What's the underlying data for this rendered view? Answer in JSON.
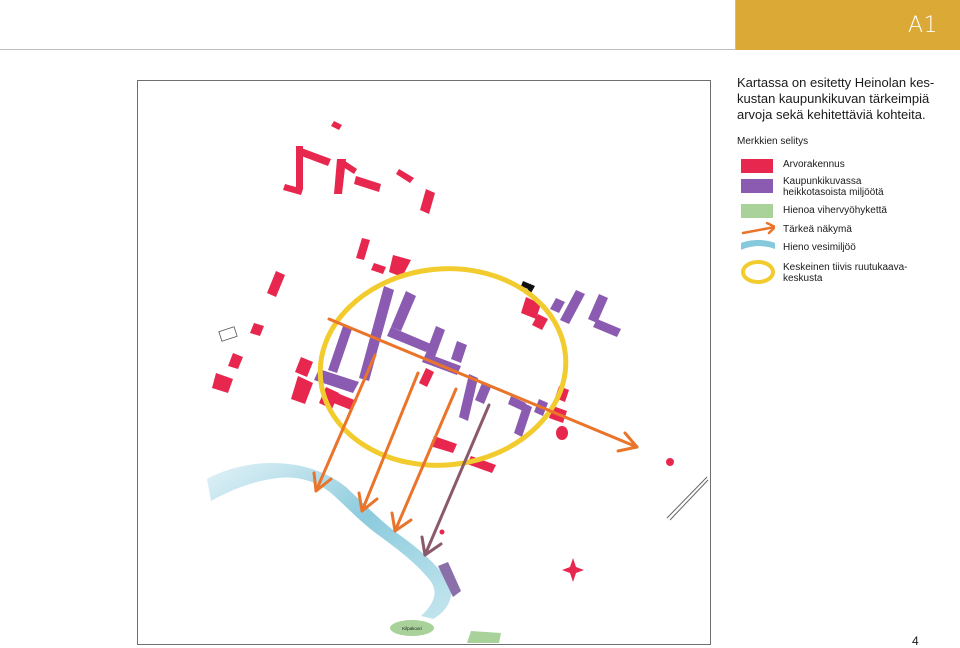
{
  "badge": {
    "label": "A1",
    "color": "#dba935"
  },
  "intro": {
    "lines": [
      "Kartassa on esitetty Heinolan kes-",
      "kustan kaupunkikuvan tärkeimpiä",
      "arvoja sekä kehitettäviä kohteita."
    ]
  },
  "legend": {
    "title": "Merkkien selitys",
    "items": [
      {
        "label": "Arvorakennus",
        "color": "#e8274f",
        "icon": "red-rectangle"
      },
      {
        "label_lines": [
          "Kaupunkikuvassa",
          "heikkotasoista  miljöötä"
        ],
        "color": "#8a5bb0",
        "icon": "purple-rectangle"
      },
      {
        "label": "Hienoa vihervyöhykettä",
        "color": "#a8d29a",
        "icon": "green-rectangle"
      },
      {
        "label": "Tärkeä näkymä",
        "color": "#ea7429",
        "icon": "orange-arrow"
      },
      {
        "label": "Hieno vesimiljöö",
        "color": "#86c9dc",
        "icon": "blue-water-stroke"
      },
      {
        "label_lines": [
          "Keskeinen tiivis ruutukaava-",
          "keskusta"
        ],
        "color": "#f2cc2e",
        "icon": "yellow-ellipse"
      }
    ]
  },
  "map": {
    "park_label": "Kilpakoori"
  },
  "page": {
    "number": "4"
  }
}
